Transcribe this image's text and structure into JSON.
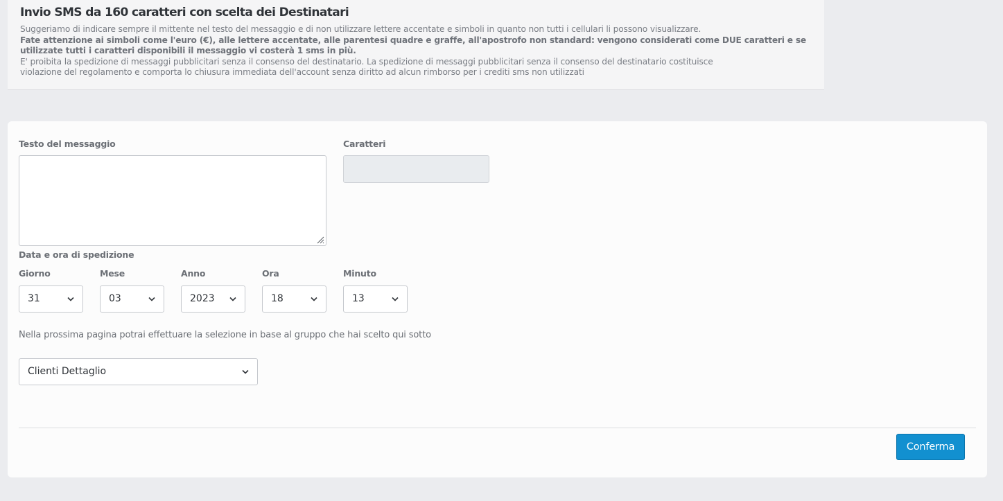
{
  "info": {
    "title": "Invio SMS da 160 caratteri con scelta dei Destinatari",
    "line1": "Suggeriamo di indicare sempre il mittente nel testo del messaggio e di non utilizzare lettere accentate e simboli in quanto non tutti i cellulari li possono visualizzare.",
    "bold1": "Fate attenzione ai simboli come l'euro (€), alle lettere accentate, alle parentesi quadre e graffe, all'apostrofo non standard: vengono considerati come DUE caratteri e se",
    "bold2": "utilizzate tutti i caratteri disponibili il messaggio vi costerà 1 sms in più.",
    "line2": "E' proibita la spedizione di messaggi pubblicitari senza il consenso del destinatario. La spedizione di messaggi pubblicitari senza il consenso del destinatario costituisce",
    "line3": "violazione del regolamento e comporta lo chiusura immediata dell'account senza diritto ad alcun rimborso per i crediti sms non utilizzati"
  },
  "form": {
    "message_label": "Testo del messaggio",
    "message_value": "",
    "chars_label": "Caratteri",
    "chars_value": "",
    "datetime_label": "Data e ora di spedizione",
    "day_label": "Giorno",
    "day_value": "31",
    "month_label": "Mese",
    "month_value": "03",
    "year_label": "Anno",
    "year_value": "2023",
    "hour_label": "Ora",
    "hour_value": "18",
    "minute_label": "Minuto",
    "minute_value": "13",
    "group_hint": "Nella prossima pagina potrai effettuare la selezione in base al gruppo che hai scelto qui sotto",
    "group_value": "Clienti Dettaglio",
    "confirm_label": "Conferma"
  },
  "colors": {
    "accent": "#1290d0",
    "background": "#ebecef"
  }
}
